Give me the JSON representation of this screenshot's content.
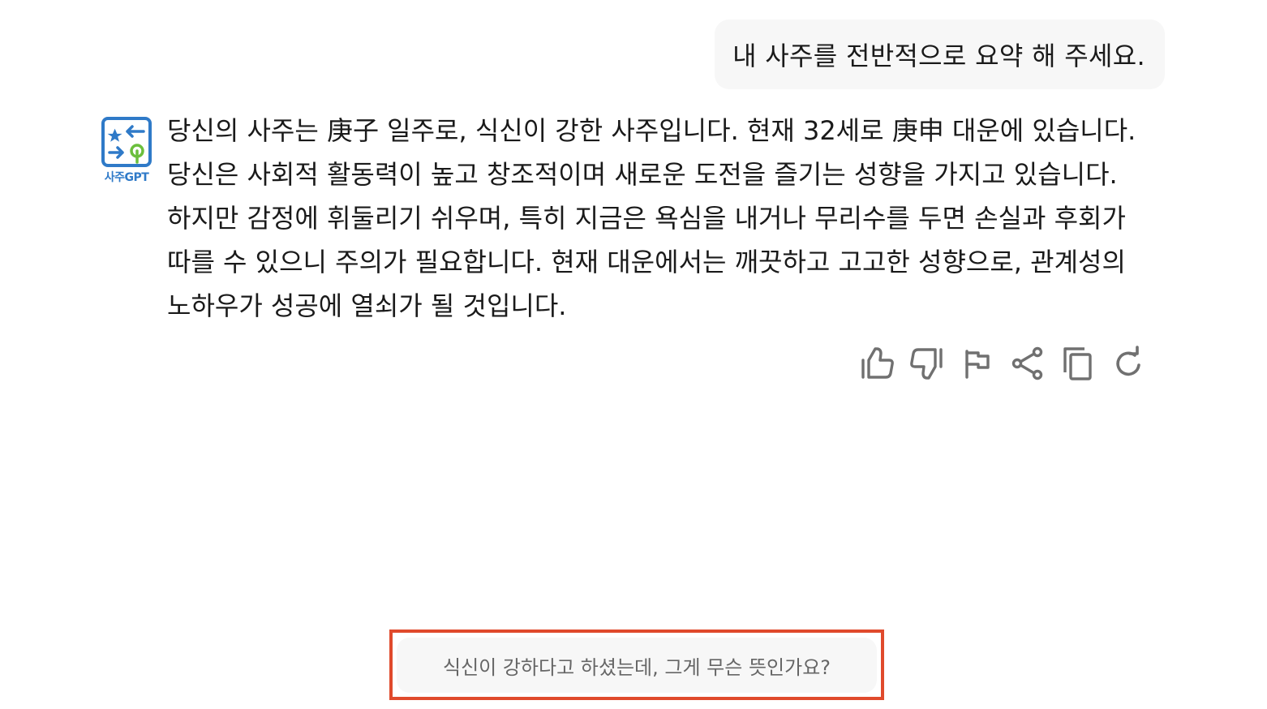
{
  "chat": {
    "user_message": "내 사주를 전반적으로 요약 해 주세요.",
    "bot": {
      "name": "사주GPT",
      "message": "당신의 사주는 庚子 일주로, 식신이 강한 사주입니다. 현재 32세로 庚申 대운에 있습니다. 당신은 사회적 활동력이 높고 창조적이며 새로운 도전을 즐기는 성향을 가지고 있습니다. 하지만 감정에 휘둘리기 쉬우며, 특히 지금은 욕심을 내거나 무리수를 두면 손실과 후회가 따를 수 있으니 주의가 필요합니다. 현재 대운에서는 깨끗하고 고고한 성향으로, 관계성의 노하우가 성공에 열쇠가 될 것입니다."
    },
    "actions": [
      {
        "icon": "thumbs-up-icon"
      },
      {
        "icon": "thumbs-down-icon"
      },
      {
        "icon": "flag-icon"
      },
      {
        "icon": "share-icon"
      },
      {
        "icon": "copy-icon"
      },
      {
        "icon": "refresh-icon"
      }
    ],
    "suggestion": "식신이 강하다고 하셨는데, 그게 무슨 뜻인가요?"
  },
  "colors": {
    "brand": "#2f7ac8",
    "highlight_border": "#e04a2c",
    "bubble_bg": "#f7f7f7",
    "icon": "#707070"
  }
}
